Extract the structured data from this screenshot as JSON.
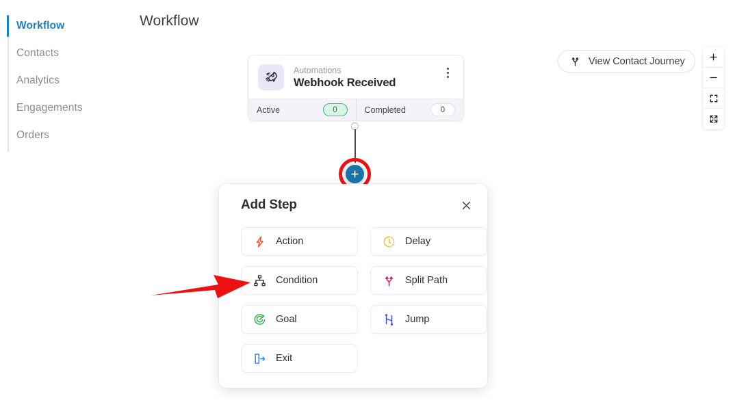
{
  "sidebar": {
    "items": [
      {
        "label": "Workflow",
        "active": true
      },
      {
        "label": "Contacts",
        "active": false
      },
      {
        "label": "Analytics",
        "active": false
      },
      {
        "label": "Engagements",
        "active": false
      },
      {
        "label": "Orders",
        "active": false
      }
    ]
  },
  "header": {
    "title": "Workflow"
  },
  "toolbar": {
    "journey_label": "View Contact Journey",
    "journey_icon": "split-path-icon"
  },
  "zoom_controls": [
    {
      "name": "zoom-in",
      "icon": "plus-icon"
    },
    {
      "name": "zoom-out",
      "icon": "minus-icon"
    },
    {
      "name": "fit-view",
      "icon": "frame-icon"
    },
    {
      "name": "fullscreen",
      "icon": "expand-arrows-icon"
    }
  ],
  "node": {
    "icon": "rocket-icon",
    "category": "Automations",
    "title": "Webhook Received",
    "menu_icon": "kebab-menu-icon",
    "stats": [
      {
        "label": "Active",
        "value": "0",
        "style": "green"
      },
      {
        "label": "Completed",
        "value": "0",
        "style": "plain"
      }
    ]
  },
  "add_node": {
    "icon": "plus-icon",
    "highlighted": true
  },
  "panel": {
    "title": "Add Step",
    "close_icon": "close-icon",
    "steps": [
      {
        "label": "Action",
        "icon": "lightning-bolt-icon",
        "color": "#f0512c"
      },
      {
        "label": "Delay",
        "icon": "clock-icon",
        "color": "#f5b63f"
      },
      {
        "label": "Condition",
        "icon": "hierarchy-icon",
        "color": "#2b2f36"
      },
      {
        "label": "Split Path",
        "icon": "split-path-icon",
        "color": "#e8196b"
      },
      {
        "label": "Goal",
        "icon": "target-icon",
        "color": "#2eac4a"
      },
      {
        "label": "Jump",
        "icon": "jump-icon",
        "color": "#4355e8"
      },
      {
        "label": "Exit",
        "icon": "exit-door-icon",
        "color": "#3a7ff0"
      }
    ]
  },
  "annotation": {
    "arrow_color": "#ee1111",
    "ring_color": "#ee1111",
    "points_to": "Condition"
  },
  "colors": {
    "accent": "#1b7fc4",
    "node_add": "#1a74a8",
    "panel_bg": "#ffffff"
  }
}
